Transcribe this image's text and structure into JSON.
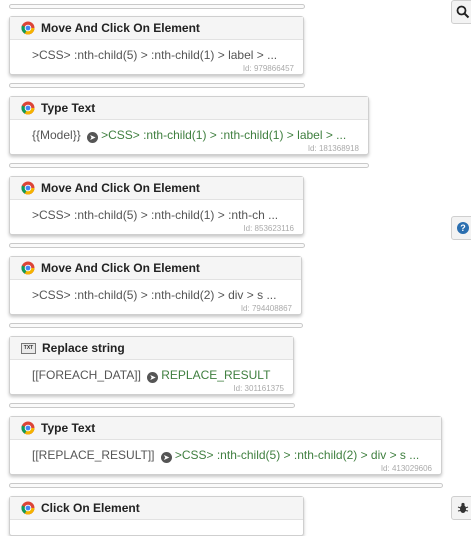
{
  "cards": [
    {
      "title": "Move And Click On Element",
      "icon": "chrome-icon",
      "value_prefix": "",
      "selector": ">CSS> :nth-child(5) > :nth-child(1) > label > ...",
      "id_label": "Id: 979866457"
    },
    {
      "title": "Type Text",
      "icon": "chrome-icon",
      "value_prefix": "{{Model}}",
      "selector": ">CSS> :nth-child(1) > :nth-child(1) > label > ...",
      "id_label": "Id: 181368918"
    },
    {
      "title": "Move And Click On Element",
      "icon": "chrome-icon",
      "value_prefix": "",
      "selector": ">CSS> :nth-child(5) > :nth-child(1) > :nth-ch ...",
      "id_label": "Id: 853623116"
    },
    {
      "title": "Move And Click On Element",
      "icon": "chrome-icon",
      "value_prefix": "",
      "selector": ">CSS> :nth-child(5) > :nth-child(2) > div > s ...",
      "id_label": "Id: 794408867"
    },
    {
      "title": "Replace string",
      "icon": "replace-string-icon",
      "value_prefix": "[[FOREACH_DATA]]",
      "selector": "REPLACE_RESULT",
      "id_label": "Id: 301161375"
    },
    {
      "title": "Type Text",
      "icon": "chrome-icon",
      "value_prefix": "[[REPLACE_RESULT]]",
      "selector": ">CSS> :nth-child(5) > :nth-child(2) > div > s ...",
      "id_label": "Id: 413029606"
    },
    {
      "title": "Click On Element",
      "icon": "chrome-icon",
      "value_prefix": "",
      "selector": "",
      "id_label": ""
    }
  ],
  "colors": {
    "selector_plain": "#555555",
    "selector_after_arrow": "#3f7f3f",
    "card_header": "#f5f5f5"
  },
  "side_buttons": [
    "search-icon",
    "help-icon",
    "bug-icon"
  ],
  "string_icon_text": "TXT"
}
